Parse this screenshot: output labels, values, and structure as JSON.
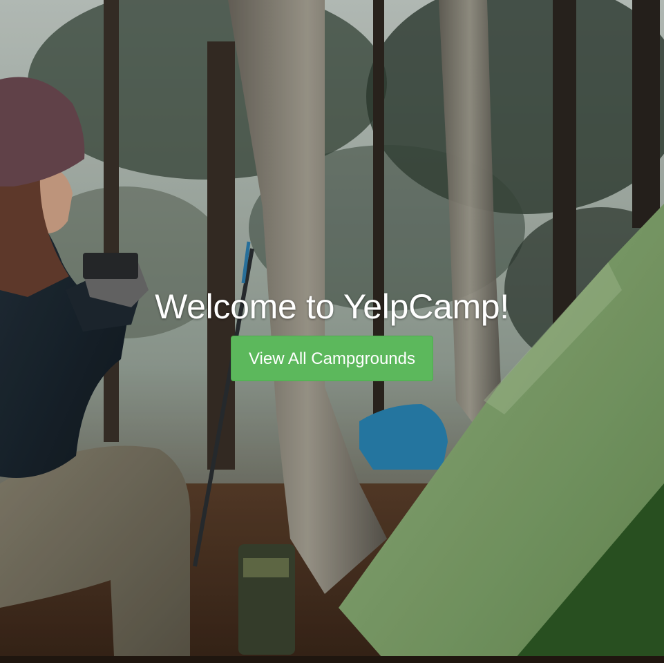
{
  "hero": {
    "title": "Welcome to YelpCamp!",
    "button_label": "View All Campgrounds"
  },
  "background": {
    "subject": "woman drinking from a mug next to a green tent in a pine forest"
  },
  "colors": {
    "button": "#5cb85c",
    "button_border": "#4cae4c",
    "title_text": "#ffffff",
    "tent": "#8fb27a"
  }
}
